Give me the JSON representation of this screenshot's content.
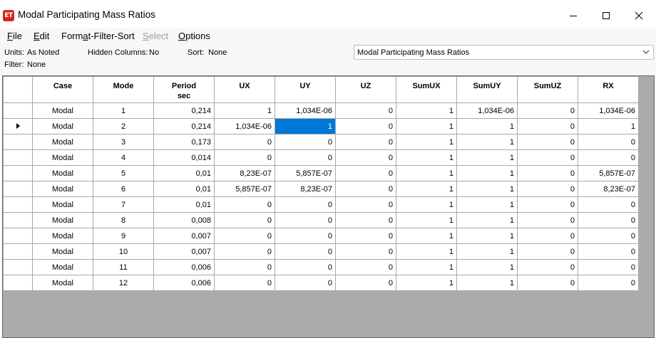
{
  "window": {
    "app_icon_text": "ET",
    "title": "Modal Participating Mass Ratios"
  },
  "menu": [
    {
      "label": "File",
      "enabled": true
    },
    {
      "label": "Edit",
      "enabled": true
    },
    {
      "label": "Format-Filter-Sort",
      "enabled": true
    },
    {
      "label": "Select",
      "enabled": false
    },
    {
      "label": "Options",
      "enabled": true
    }
  ],
  "info": {
    "units_label": "Units:",
    "units_value": "As Noted",
    "hidden_label": "Hidden Columns:",
    "hidden_value": "No",
    "sort_label": "Sort:",
    "sort_value": "None",
    "filter_label": "Filter:",
    "filter_value": "None",
    "table_select": "Modal Participating Mass Ratios"
  },
  "table": {
    "columns": [
      {
        "line1": "Case",
        "line2": ""
      },
      {
        "line1": "Mode",
        "line2": ""
      },
      {
        "line1": "Period",
        "line2": "sec"
      },
      {
        "line1": "UX",
        "line2": ""
      },
      {
        "line1": "UY",
        "line2": ""
      },
      {
        "line1": "UZ",
        "line2": ""
      },
      {
        "line1": "SumUX",
        "line2": ""
      },
      {
        "line1": "SumUY",
        "line2": ""
      },
      {
        "line1": "SumUZ",
        "line2": ""
      },
      {
        "line1": "RX",
        "line2": ""
      }
    ],
    "current_row": 1,
    "selected_cell": {
      "row": 1,
      "col": 4
    },
    "rows": [
      [
        "Modal",
        "1",
        "0,214",
        "1",
        "1,034E-06",
        "0",
        "1",
        "1,034E-06",
        "0",
        "1,034E-06"
      ],
      [
        "Modal",
        "2",
        "0,214",
        "1,034E-06",
        "1",
        "0",
        "1",
        "1",
        "0",
        "1"
      ],
      [
        "Modal",
        "3",
        "0,173",
        "0",
        "0",
        "0",
        "1",
        "1",
        "0",
        "0"
      ],
      [
        "Modal",
        "4",
        "0,014",
        "0",
        "0",
        "0",
        "1",
        "1",
        "0",
        "0"
      ],
      [
        "Modal",
        "5",
        "0,01",
        "8,23E-07",
        "5,857E-07",
        "0",
        "1",
        "1",
        "0",
        "5,857E-07"
      ],
      [
        "Modal",
        "6",
        "0,01",
        "5,857E-07",
        "8,23E-07",
        "0",
        "1",
        "1",
        "0",
        "8,23E-07"
      ],
      [
        "Modal",
        "7",
        "0,01",
        "0",
        "0",
        "0",
        "1",
        "1",
        "0",
        "0"
      ],
      [
        "Modal",
        "8",
        "0,008",
        "0",
        "0",
        "0",
        "1",
        "1",
        "0",
        "0"
      ],
      [
        "Modal",
        "9",
        "0,007",
        "0",
        "0",
        "0",
        "1",
        "1",
        "0",
        "0"
      ],
      [
        "Modal",
        "10",
        "0,007",
        "0",
        "0",
        "0",
        "1",
        "1",
        "0",
        "0"
      ],
      [
        "Modal",
        "11",
        "0,006",
        "0",
        "0",
        "0",
        "1",
        "1",
        "0",
        "0"
      ],
      [
        "Modal",
        "12",
        "0,006",
        "0",
        "0",
        "0",
        "1",
        "1",
        "0",
        "0"
      ]
    ]
  }
}
